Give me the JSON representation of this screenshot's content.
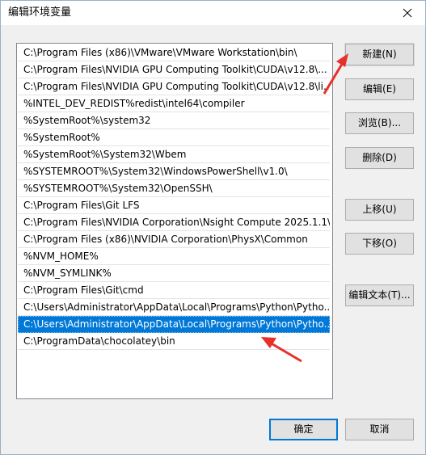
{
  "window": {
    "title": "编辑环境变量"
  },
  "path_list": [
    "C:\\Program Files (x86)\\VMware\\VMware Workstation\\bin\\",
    "C:\\Program Files\\NVIDIA GPU Computing Toolkit\\CUDA\\v12.8\\...",
    "C:\\Program Files\\NVIDIA GPU Computing Toolkit\\CUDA\\v12.8\\li...",
    "%INTEL_DEV_REDIST%redist\\intel64\\compiler",
    "%SystemRoot%\\system32",
    "%SystemRoot%",
    "%SystemRoot%\\System32\\Wbem",
    "%SYSTEMROOT%\\System32\\WindowsPowerShell\\v1.0\\",
    "%SYSTEMROOT%\\System32\\OpenSSH\\",
    "C:\\Program Files\\Git LFS",
    "C:\\Program Files\\NVIDIA Corporation\\Nsight Compute 2025.1.1\\",
    "C:\\Program Files (x86)\\NVIDIA Corporation\\PhysX\\Common",
    "%NVM_HOME%",
    "%NVM_SYMLINK%",
    "C:\\Program Files\\Git\\cmd",
    "C:\\Users\\Administrator\\AppData\\Local\\Programs\\Python\\Pytho...",
    "C:\\Users\\Administrator\\AppData\\Local\\Programs\\Python\\Pytho...",
    "C:\\ProgramData\\chocolatey\\bin"
  ],
  "selected_index": 16,
  "buttons": {
    "new": "新建(N)",
    "edit": "编辑(E)",
    "browse": "浏览(B)...",
    "delete": "删除(D)",
    "move_up": "上移(U)",
    "move_down": "下移(O)",
    "edit_text": "编辑文本(T)...",
    "ok": "确定",
    "cancel": "取消"
  },
  "colors": {
    "selection": "#0078d7",
    "annotation_arrow": "#e8302a"
  }
}
